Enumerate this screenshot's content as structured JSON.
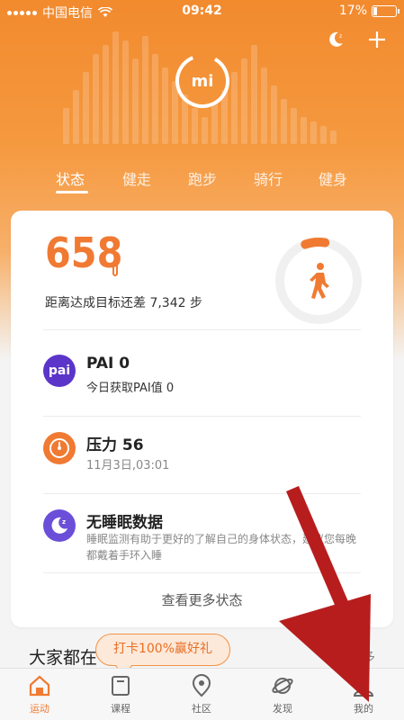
{
  "status_bar": {
    "carrier": "中国电信",
    "time": "09:42",
    "battery": "17%"
  },
  "header": {
    "logo_text": "mi",
    "night_icon": "moon-icon",
    "add_icon": "plus-icon"
  },
  "tabs": [
    {
      "label": "状态",
      "active": true
    },
    {
      "label": "健走",
      "active": false
    },
    {
      "label": "跑步",
      "active": false
    },
    {
      "label": "骑行",
      "active": false
    },
    {
      "label": "健身",
      "active": false
    }
  ],
  "summary": {
    "steps": "658",
    "goal_text": "距离达成目标还差 7,342 步",
    "progress_fraction": 0.0823
  },
  "rows": {
    "pai": {
      "icon_text": "pai",
      "title": "PAI 0",
      "sub": "今日获取PAI值 0"
    },
    "stress": {
      "title": "压力 56",
      "sub": "11月3日,03:01"
    },
    "sleep": {
      "title": "无睡眠数据",
      "desc": "睡眠监测有助于更好的了解自己的身体状态，建议您每晚都戴着手环入睡"
    }
  },
  "more_link": "查看更多状态",
  "section": {
    "title": "大家都在",
    "more": "更多"
  },
  "promo": "打卡100%赢好礼",
  "navbar": [
    {
      "label": "运动",
      "active": true
    },
    {
      "label": "课程",
      "active": false
    },
    {
      "label": "社区",
      "active": false
    },
    {
      "label": "发现",
      "active": false
    },
    {
      "label": "我的",
      "active": false
    }
  ],
  "colors": {
    "accent": "#f07a32",
    "pai": "#5b35c9",
    "stress": "#f07a32",
    "sleep": "#6b4fd8",
    "arrow": "#b81d1d"
  }
}
